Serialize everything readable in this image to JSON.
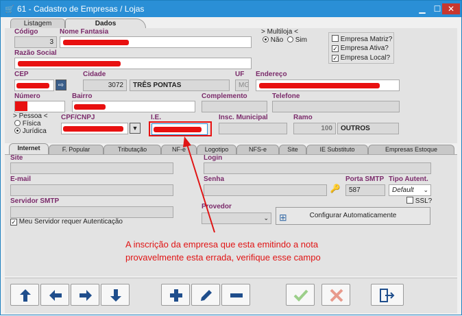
{
  "window": {
    "title": "61 - Cadastro de Empresas / Lojas"
  },
  "top_tabs": [
    "Listagem",
    "Dados"
  ],
  "fields": {
    "codigo": {
      "label": "Código",
      "value": "3"
    },
    "nome_fantasia": {
      "label": "Nome Fantasia"
    },
    "multiloja": {
      "label": "Multiloja",
      "options": [
        "Não",
        "Sim"
      ],
      "selected": "Não"
    },
    "razao_social": {
      "label": "Razão Social"
    },
    "cep": {
      "label": "CEP"
    },
    "cidade": {
      "label": "Cidade",
      "code": "3072",
      "name": "TRÊS PONTAS"
    },
    "uf": {
      "label": "UF",
      "value": "MG"
    },
    "endereco": {
      "label": "Endereço"
    },
    "numero": {
      "label": "Número"
    },
    "bairro": {
      "label": "Bairro"
    },
    "complemento": {
      "label": "Complemento"
    },
    "telefone": {
      "label": "Telefone"
    },
    "pessoa": {
      "label": "Pessoa",
      "options": [
        "Física",
        "Jurídica"
      ],
      "selected": "Jurídica"
    },
    "cpf_cnpj": {
      "label": "CPF/CNPJ"
    },
    "ie": {
      "label": "I.E."
    },
    "insc_municipal": {
      "label": "Insc. Municipal"
    },
    "ramo": {
      "label": "Ramo",
      "code": "100",
      "name": "OUTROS"
    }
  },
  "empresa_checks": [
    {
      "label": "Empresa Matriz?",
      "checked": false
    },
    {
      "label": "Empresa Ativa?",
      "checked": true
    },
    {
      "label": "Empresa Local?",
      "checked": true
    }
  ],
  "inner_tabs": [
    "Internet",
    "F. Popular",
    "Tributação",
    "NF-e",
    "Logotipo",
    "NFS-e",
    "Site",
    "IE Substituto",
    "Empresas Estoque"
  ],
  "internet": {
    "site_label": "Site",
    "login_label": "Login",
    "email_label": "E-mail",
    "senha_label": "Senha",
    "porta_label": "Porta SMTP",
    "porta_value": "587",
    "tipo_label": "Tipo Autent.",
    "tipo_value": "Default",
    "ssl_label": "SSL?",
    "smtp_label": "Servidor SMTP",
    "provedor_label": "Provedor",
    "meu_servidor_label": "Meu Servidor requer Autenticação",
    "configurar_label": "Configurar Automaticamente"
  },
  "annotation": {
    "line1": "A inscrição da empresa que esta emitindo a nota",
    "line2": "provavelmente esta errada, verifique esse campo",
    "color": "#e01414"
  },
  "colors": {
    "title": "#2a8fd6",
    "label": "#7a2a6a",
    "highlight": "#e81010"
  }
}
